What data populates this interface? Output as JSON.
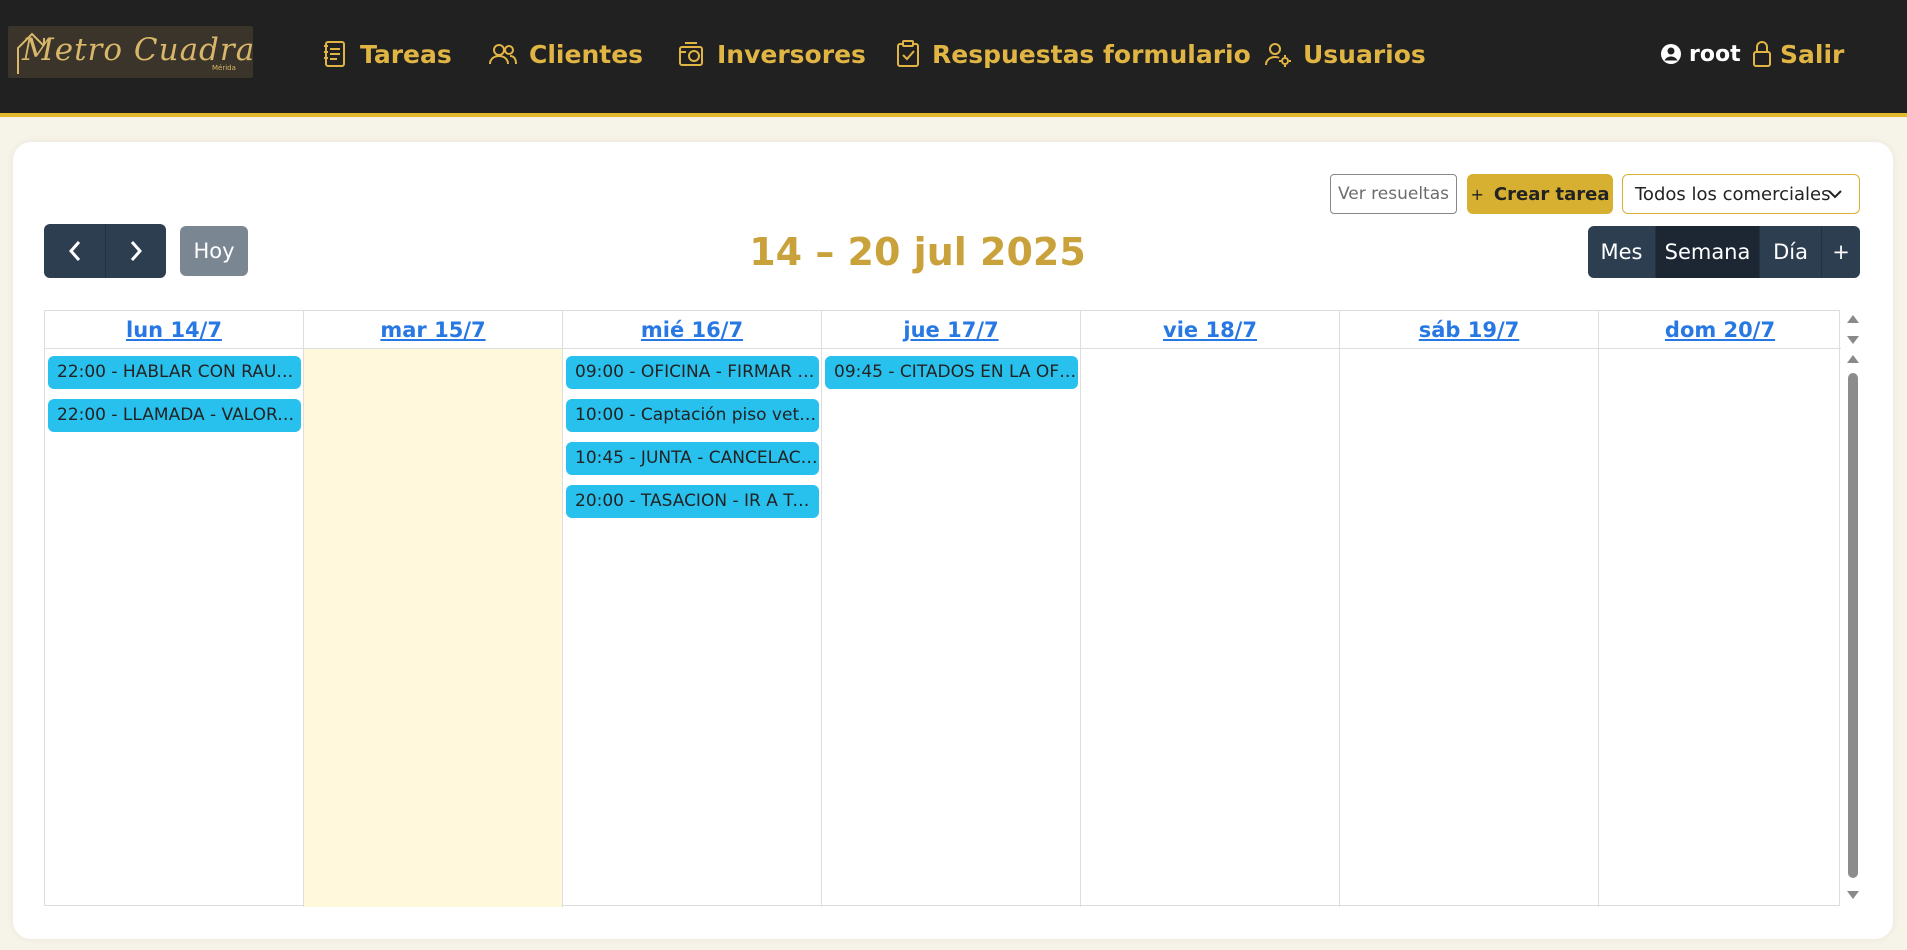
{
  "brand": {
    "logo_text": "Metro Cuadrado",
    "logo_sub": "Mérida"
  },
  "nav": {
    "items": [
      {
        "label": "Tareas",
        "icon": "tasks-icon"
      },
      {
        "label": "Clientes",
        "icon": "users-icon"
      },
      {
        "label": "Inversores",
        "icon": "investors-icon"
      },
      {
        "label": "Respuestas formulario",
        "icon": "clipboard-check-icon"
      },
      {
        "label": "Usuarios",
        "icon": "user-gear-icon"
      }
    ],
    "user": "root",
    "logout": "Salir"
  },
  "toolbar": {
    "results_label": "Ver resueltas",
    "create_label": "Crear tarea",
    "create_prefix": "+",
    "filter_value": "Todos los comerciales"
  },
  "calendar": {
    "title": "14 – 20 jul 2025",
    "today_label": "Hoy",
    "views": [
      "Mes",
      "Semana",
      "Día",
      "+"
    ],
    "active_view": "Semana",
    "days": [
      {
        "label": "lun 14/7",
        "today": false,
        "events": [
          "22:00 - HABLAR CON RAUL ...",
          "22:00 - LLAMADA - VALORA..."
        ]
      },
      {
        "label": "mar 15/7",
        "today": true,
        "events": []
      },
      {
        "label": "mié 16/7",
        "today": false,
        "events": [
          "09:00 - OFICINA - FIRMAR C...",
          "10:00 - Captación piso veton...",
          "10:45 - JUNTA - CANCELACI...",
          "20:00 - TASACION - IR A TAS..."
        ]
      },
      {
        "label": "jue 17/7",
        "today": false,
        "events": [
          "09:45 - CITADOS EN LA OFIC..."
        ]
      },
      {
        "label": "vie 18/7",
        "today": false,
        "events": []
      },
      {
        "label": "sáb 19/7",
        "today": false,
        "events": []
      },
      {
        "label": "dom 20/7",
        "today": false,
        "events": []
      }
    ]
  },
  "colors": {
    "accent": "#e1b544",
    "navbar": "#212121",
    "event": "#28c1ee",
    "today_bg": "#fff8dd",
    "title": "#c9a23c"
  }
}
